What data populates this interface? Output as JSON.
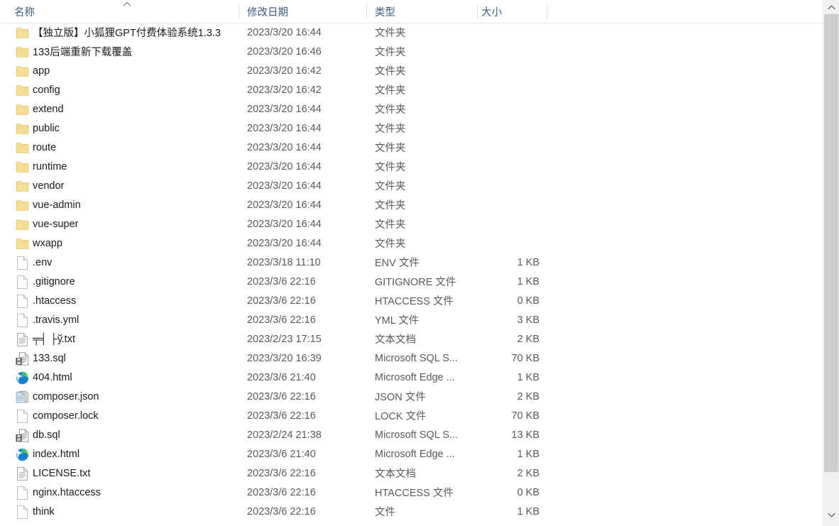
{
  "window": {
    "app": "Windows File Explorer",
    "view": "details"
  },
  "columns": {
    "name_label": "名称",
    "date_label": "修改日期",
    "type_label": "类型",
    "size_label": "大小",
    "sort_indicator": "ascending",
    "sorted_by": "名称"
  },
  "colors": {
    "header_text": "#3f5d7e",
    "row_text": "#1a1a1a",
    "meta_text": "#5a5a5a",
    "folder_icon": "#f6dd95",
    "folder_icon_edge": "#e9c96a",
    "scrollbar_track": "#f0f0f0",
    "scrollbar_thumb": "#cdcdcd",
    "background": "#ffffff"
  },
  "scrollbar": {
    "up_arrow": "⌃",
    "down_arrow": "⌄",
    "position": "top"
  },
  "rows": [
    {
      "icon": "folder-icon",
      "name": "【独立版】小狐狸GPT付费体验系统1.3.3",
      "date": "2023/3/20 16:44",
      "type": "文件夹",
      "size": ""
    },
    {
      "icon": "folder-icon",
      "name": "133后端重新下载覆盖",
      "date": "2023/3/20 16:46",
      "type": "文件夹",
      "size": ""
    },
    {
      "icon": "folder-icon",
      "name": "app",
      "date": "2023/3/20 16:42",
      "type": "文件夹",
      "size": ""
    },
    {
      "icon": "folder-icon",
      "name": "config",
      "date": "2023/3/20 16:42",
      "type": "文件夹",
      "size": ""
    },
    {
      "icon": "folder-icon",
      "name": "extend",
      "date": "2023/3/20 16:44",
      "type": "文件夹",
      "size": ""
    },
    {
      "icon": "folder-icon",
      "name": "public",
      "date": "2023/3/20 16:44",
      "type": "文件夹",
      "size": ""
    },
    {
      "icon": "folder-icon",
      "name": "route",
      "date": "2023/3/20 16:44",
      "type": "文件夹",
      "size": ""
    },
    {
      "icon": "folder-icon",
      "name": "runtime",
      "date": "2023/3/20 16:44",
      "type": "文件夹",
      "size": ""
    },
    {
      "icon": "folder-icon",
      "name": "vendor",
      "date": "2023/3/20 16:44",
      "type": "文件夹",
      "size": ""
    },
    {
      "icon": "folder-icon",
      "name": "vue-admin",
      "date": "2023/3/20 16:44",
      "type": "文件夹",
      "size": ""
    },
    {
      "icon": "folder-icon",
      "name": "vue-super",
      "date": "2023/3/20 16:44",
      "type": "文件夹",
      "size": ""
    },
    {
      "icon": "folder-icon",
      "name": "wxapp",
      "date": "2023/3/20 16:44",
      "type": "文件夹",
      "size": ""
    },
    {
      "icon": "blank-file-icon",
      "name": ".env",
      "date": "2023/3/18 11:10",
      "type": "ENV 文件",
      "size": "1 KB"
    },
    {
      "icon": "blank-file-icon",
      "name": ".gitignore",
      "date": "2023/3/6 22:16",
      "type": "GITIGNORE 文件",
      "size": "1 KB"
    },
    {
      "icon": "blank-file-icon",
      "name": ".htaccess",
      "date": "2023/3/6 22:16",
      "type": "HTACCESS 文件",
      "size": "0 KB"
    },
    {
      "icon": "blank-file-icon",
      "name": ".travis.yml",
      "date": "2023/3/6 22:16",
      "type": "YML 文件",
      "size": "3 KB"
    },
    {
      "icon": "text-file-icon",
      "name": "╤╡ ├ў.txt",
      "date": "2023/2/23 17:15",
      "type": "文本文档",
      "size": "2 KB"
    },
    {
      "icon": "sql-file-icon",
      "name": "133.sql",
      "date": "2023/3/20 16:39",
      "type": "Microsoft SQL S...",
      "size": "70 KB"
    },
    {
      "icon": "edge-html-icon",
      "name": "404.html",
      "date": "2023/3/6 21:40",
      "type": "Microsoft Edge ...",
      "size": "1 KB"
    },
    {
      "icon": "json-file-icon",
      "name": "composer.json",
      "date": "2023/3/6 22:16",
      "type": "JSON 文件",
      "size": "2 KB"
    },
    {
      "icon": "blank-file-icon",
      "name": "composer.lock",
      "date": "2023/3/6 22:16",
      "type": "LOCK 文件",
      "size": "70 KB"
    },
    {
      "icon": "sql-file-icon",
      "name": "db.sql",
      "date": "2023/2/24 21:38",
      "type": "Microsoft SQL S...",
      "size": "13 KB"
    },
    {
      "icon": "edge-html-icon",
      "name": "index.html",
      "date": "2023/3/6 21:40",
      "type": "Microsoft Edge ...",
      "size": "1 KB"
    },
    {
      "icon": "text-file-icon",
      "name": "LICENSE.txt",
      "date": "2023/3/6 22:16",
      "type": "文本文档",
      "size": "2 KB"
    },
    {
      "icon": "blank-file-icon",
      "name": "nginx.htaccess",
      "date": "2023/3/6 22:16",
      "type": "HTACCESS 文件",
      "size": "0 KB"
    },
    {
      "icon": "blank-file-icon",
      "name": "think",
      "date": "2023/3/6 22:16",
      "type": "文件",
      "size": "1 KB"
    }
  ]
}
